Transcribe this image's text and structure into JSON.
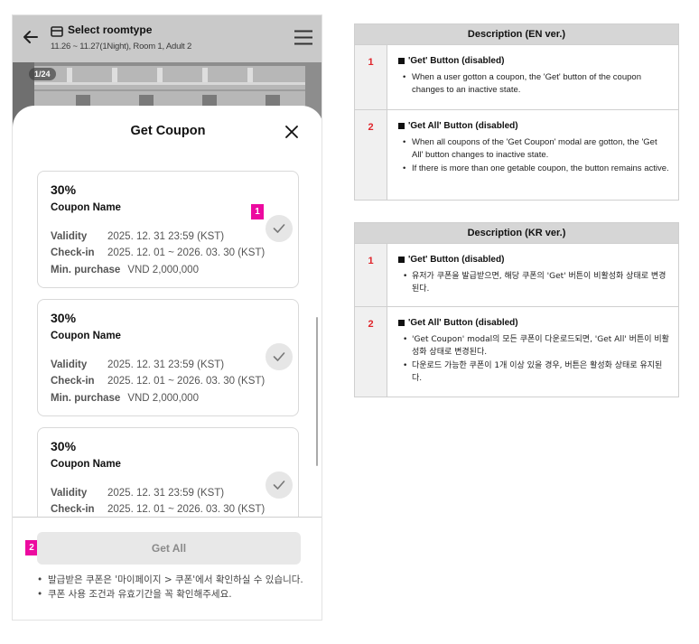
{
  "header": {
    "title": "Select roomtype",
    "subtitle": "11.26 ~ 11.27(1Night), Room 1, Adult 2"
  },
  "gallery": {
    "counter": "1/24"
  },
  "modal": {
    "title": "Get Coupon",
    "coupons": [
      {
        "percent": "30%",
        "name": "Coupon Name",
        "validity_label": "Validity",
        "validity": "2025. 12. 31 23:59 (KST)",
        "checkin_label": "Check-in",
        "checkin": "2025. 12. 01 ~ 2026. 03. 30 (KST)",
        "min_label": "Min. purchase",
        "min": "VND 2,000,000"
      },
      {
        "percent": "30%",
        "name": "Coupon Name",
        "validity_label": "Validity",
        "validity": "2025. 12. 31 23:59 (KST)",
        "checkin_label": "Check-in",
        "checkin": "2025. 12. 01 ~ 2026. 03. 30 (KST)",
        "min_label": "Min. purchase",
        "min": "VND 2,000,000"
      },
      {
        "percent": "30%",
        "name": "Coupon Name",
        "validity_label": "Validity",
        "validity": "2025. 12. 31 23:59 (KST)",
        "checkin_label": "Check-in",
        "checkin": "2025. 12. 01 ~ 2026. 03. 30 (KST)"
      }
    ],
    "get_all_label": "Get All",
    "notes": [
      "발급받은 쿠폰은 '마이페이지 > 쿠폰'에서 확인하실 수 있습니다.",
      "쿠폰 사용 조건과 유효기간을 꼭 확인해주세요."
    ]
  },
  "markers": [
    "1",
    "2"
  ],
  "description_en": {
    "header": "Description (EN ver.)",
    "items": [
      {
        "num": "1",
        "title": "'Get' Button (disabled)",
        "lines": [
          "When a user gotton a coupon, the 'Get' button of the coupon changes to an inactive state."
        ]
      },
      {
        "num": "2",
        "title": "'Get All' Button (disabled)",
        "lines": [
          "When all coupons of the 'Get Coupon' modal are gotton, the 'Get All' button changes to inactive state.",
          "If there is more than one getable coupon, the button remains active."
        ]
      }
    ]
  },
  "description_kr": {
    "header": "Description (KR ver.)",
    "items": [
      {
        "num": "1",
        "title": "'Get' Button (disabled)",
        "lines": [
          "유저가 쿠폰을 발급받으면, 해당 쿠폰의 'Get' 버튼이 비활성화 상태로 변경된다."
        ]
      },
      {
        "num": "2",
        "title": "'Get All' Button (disabled)",
        "lines": [
          "'Get Coupon' modal의 모든 쿠폰이 다운로드되면, 'Get All' 버튼이 비활성화 상태로 변경된다.",
          "다운로드 가능한 쿠폰이 1개 이상 있을 경우, 버튼은 활성화 상태로 유지된다."
        ]
      }
    ]
  },
  "colors": {
    "marker": "#ec0a9f",
    "desc_number": "#e0262c",
    "header_bg": "#c9c9c9",
    "disabled_button_bg": "#e8e8e8"
  },
  "icons": [
    "back-arrow-icon",
    "room-icon",
    "hamburger-menu-icon",
    "close-icon",
    "check-icon"
  ]
}
